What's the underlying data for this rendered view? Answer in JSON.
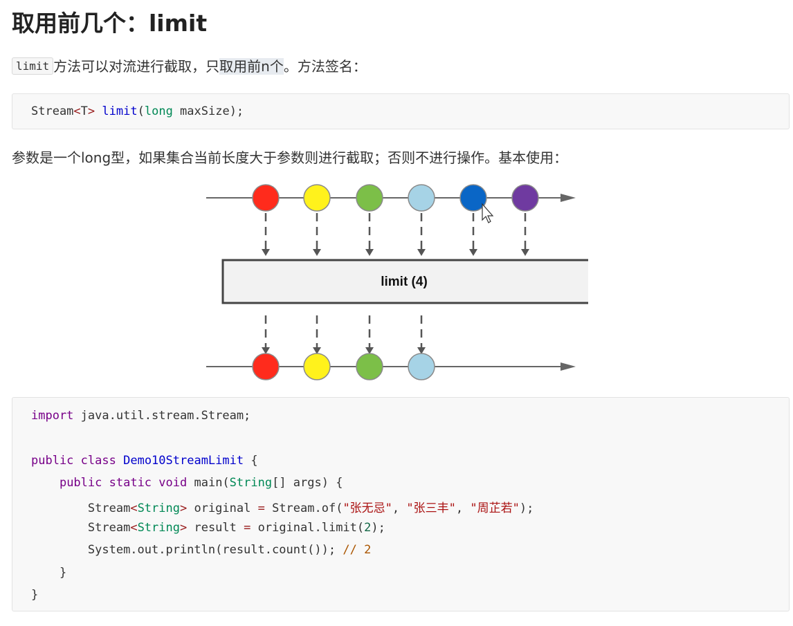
{
  "title": "取用前几个：limit",
  "intro": {
    "code_token": "limit",
    "text_before_highlight": "方法可以对流进行截取，只",
    "highlight": "取用前n个",
    "text_after": "。方法签名："
  },
  "signature": {
    "tokens": [
      "Stream",
      "<",
      "T",
      ">",
      " ",
      "limit",
      "(",
      "long",
      " maxSize);"
    ]
  },
  "description": "参数是一个long型，如果集合当前长度大于参数则进行截取；否则不进行操作。基本使用：",
  "diagram": {
    "box_label": "limit (4)",
    "input_colors": [
      "#ff2b1c",
      "#fff21c",
      "#7cbf48",
      "#a6d3e6",
      "#0a66c6",
      "#6f3aa0"
    ],
    "output_colors": [
      "#ff2b1c",
      "#fff21c",
      "#7cbf48",
      "#a6d3e6"
    ]
  },
  "code": {
    "line1": {
      "kw": "import",
      "rest": " java.util.stream.Stream;"
    },
    "line3": {
      "kw1": "public",
      "kw2": "class",
      "name": "Demo10StreamLimit",
      "rest": " {"
    },
    "line4": {
      "kw1": "public",
      "kw2": "static",
      "kw3": "void",
      "mid": " main(",
      "type": "String",
      "rest": "[] args) {"
    },
    "line5": {
      "t1": "Stream",
      "lt": "<",
      "t2": "String",
      "gt": ">",
      "mid": " original ",
      "eq": "=",
      "call": " Stream.of(",
      "s1": "\"张无忌\"",
      "c1": ", ",
      "s2": "\"张三丰\"",
      "c2": ", ",
      "s3": "\"周芷若\"",
      "end": ");"
    },
    "line6": {
      "t1": "Stream",
      "lt": "<",
      "t2": "String",
      "gt": ">",
      "mid": " result ",
      "eq": "=",
      "call": " original.limit(",
      "n": "2",
      "end": ");"
    },
    "line7": {
      "call": "System.out.println(result.count()); ",
      "comment": "// 2"
    },
    "line8": "}",
    "line9": "}"
  }
}
